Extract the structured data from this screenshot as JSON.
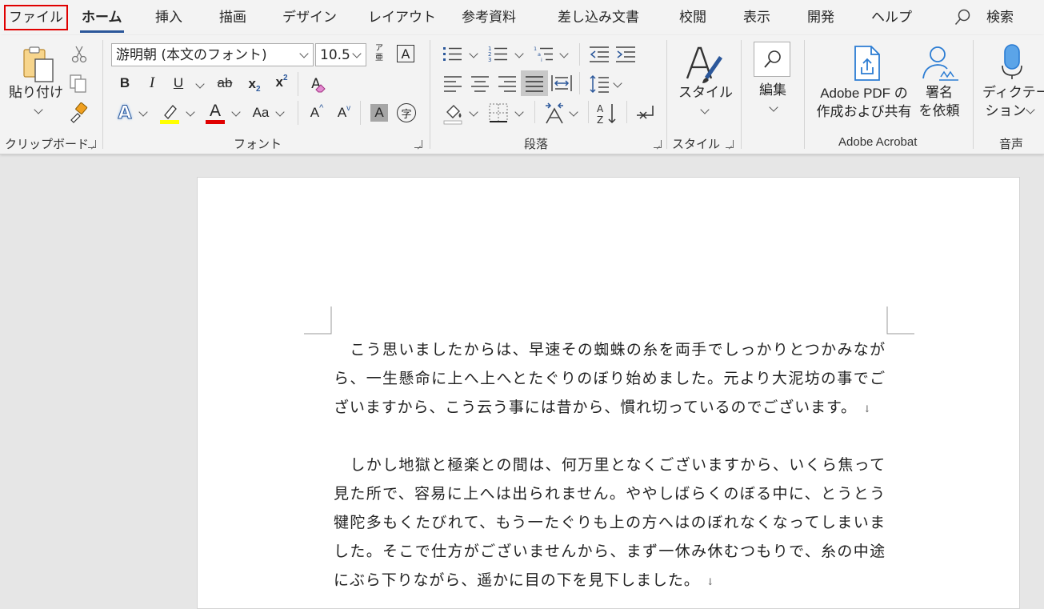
{
  "tabs": {
    "file": "ファイル",
    "home": "ホーム",
    "insert": "挿入",
    "draw": "描画",
    "design": "デザイン",
    "layout": "レイアウト",
    "references": "参考資料",
    "mailings": "差し込み文書",
    "review": "校閲",
    "view": "表示",
    "developer": "開発",
    "help": "ヘルプ",
    "search": "検索"
  },
  "ribbon": {
    "clipboard": {
      "label": "クリップボード",
      "paste": "貼り付け"
    },
    "font": {
      "label": "フォント",
      "font_name": "游明朝 (本文のフォント)",
      "font_size": "10.5",
      "bold": "B",
      "italic": "I",
      "underline": "U",
      "strikethrough": "ab",
      "subscript": "x",
      "superscript": "x",
      "change_case": "Aa",
      "enclose_char": "字",
      "phonetic_top": "ア",
      "phonetic_bottom": "亜",
      "grow": "A",
      "shrink": "A",
      "shade": "A",
      "border_char": "A",
      "clear": "A"
    },
    "paragraph": {
      "label": "段落"
    },
    "styles": {
      "label": "スタイル",
      "button": "スタイル"
    },
    "editing": {
      "button": "編集"
    },
    "acrobat": {
      "label": "Adobe Acrobat",
      "pdf_line1": "Adobe PDF の",
      "pdf_line2": "作成および共有",
      "sign_line1": "署名",
      "sign_line2": "を依頼"
    },
    "voice": {
      "label": "音声",
      "dictate_line1": "ディクテー",
      "dictate_line2": "ション"
    }
  },
  "colors": {
    "accent": "#2b579a",
    "highlight": "#ffff00",
    "font_color": "#e00000",
    "file_border": "#e00000"
  },
  "document": {
    "paragraphs": [
      "　こう思いましたからは、早速その蜘蛛の糸を両手でしっかりとつかみながら、一生懸命に上へ上へとたぐりのぼり始めました。元より大泥坊の事でございますから、こう云う事には昔から、慣れ切っているのでございます。",
      "　しかし地獄と極楽との間は、何万里となくございますから、いくら焦って見た所で、容易に上へは出られません。ややしばらくのぼる中に、とうとう犍陀多もくたびれて、もう一たぐりも上の方へはのぼれなくなってしまいました。そこで仕方がございませんから、まず一休み休むつもりで、糸の中途にぶら下りながら、遥かに目の下を見下しました。"
    ]
  }
}
